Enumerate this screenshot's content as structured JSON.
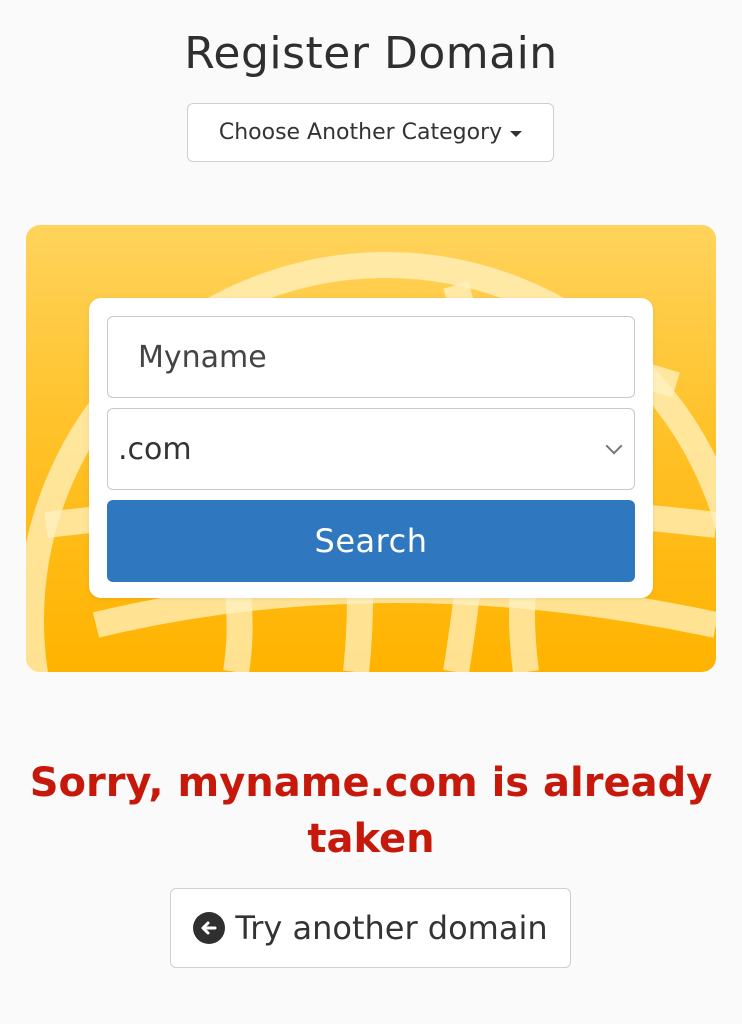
{
  "header": {
    "title": "Register Domain",
    "category_button_label": "Choose Another Category"
  },
  "search": {
    "name_value": "Myname",
    "tld_value": ".com",
    "search_button_label": "Search"
  },
  "result": {
    "message": "Sorry, myname.com is already taken",
    "try_another_label": "Try another domain"
  },
  "colors": {
    "accent_blue": "#2f78c0",
    "error_red": "#c6180b",
    "hero_yellow": "#ffc22a"
  },
  "icons": {
    "category_caret": "chevron-down-icon",
    "select_chevron": "chevron-down-icon",
    "try_another": "arrow-left-circle-icon",
    "hero_background": "globe-icon"
  }
}
